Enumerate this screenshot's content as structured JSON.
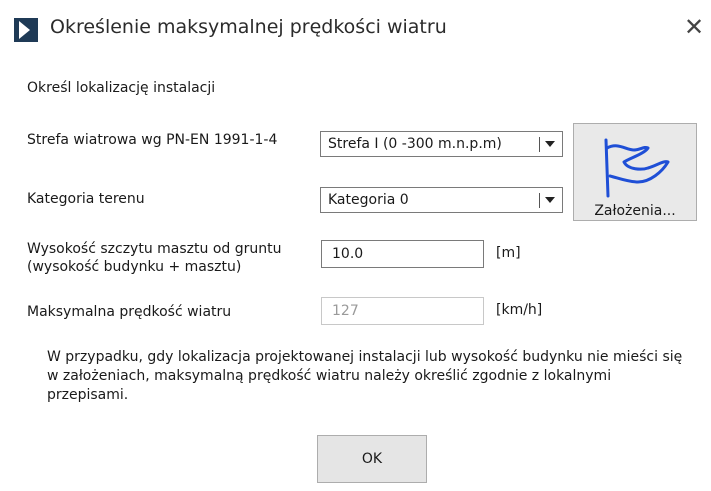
{
  "window": {
    "title": "Określenie maksymalnej prędkości wiatru",
    "close_glyph": "✕",
    "app_icon": "dialog-app-icon"
  },
  "form": {
    "heading": "Określ lokalizację instalacji",
    "wind_zone": {
      "label": "Strefa wiatrowa wg PN-EN 1991-1-4",
      "selected": "Strefa I (0 -300 m.n.p.m)"
    },
    "terrain": {
      "label": "Kategoria terenu",
      "selected": "Kategoria 0"
    },
    "height": {
      "label_line1": "Wysokość szczytu masztu od gruntu",
      "label_line2": "(wysokość budynku + masztu)",
      "value": "10.0",
      "unit": "[m]"
    },
    "max_speed": {
      "label": "Maksymalna prędkość wiatru",
      "value": "127",
      "unit": "[km/h]"
    },
    "assumptions_button": {
      "label": "Założenia...",
      "icon": "flag-icon",
      "icon_color": "#1f4fd6"
    }
  },
  "note": "W przypadku, gdy lokalizacja projektowanej instalacji lub wysokość budynku nie mieści się w założeniach, maksymalną prędkość wiatru należy określić zgodnie z lokalnymi przepisami.",
  "buttons": {
    "ok": "OK"
  }
}
